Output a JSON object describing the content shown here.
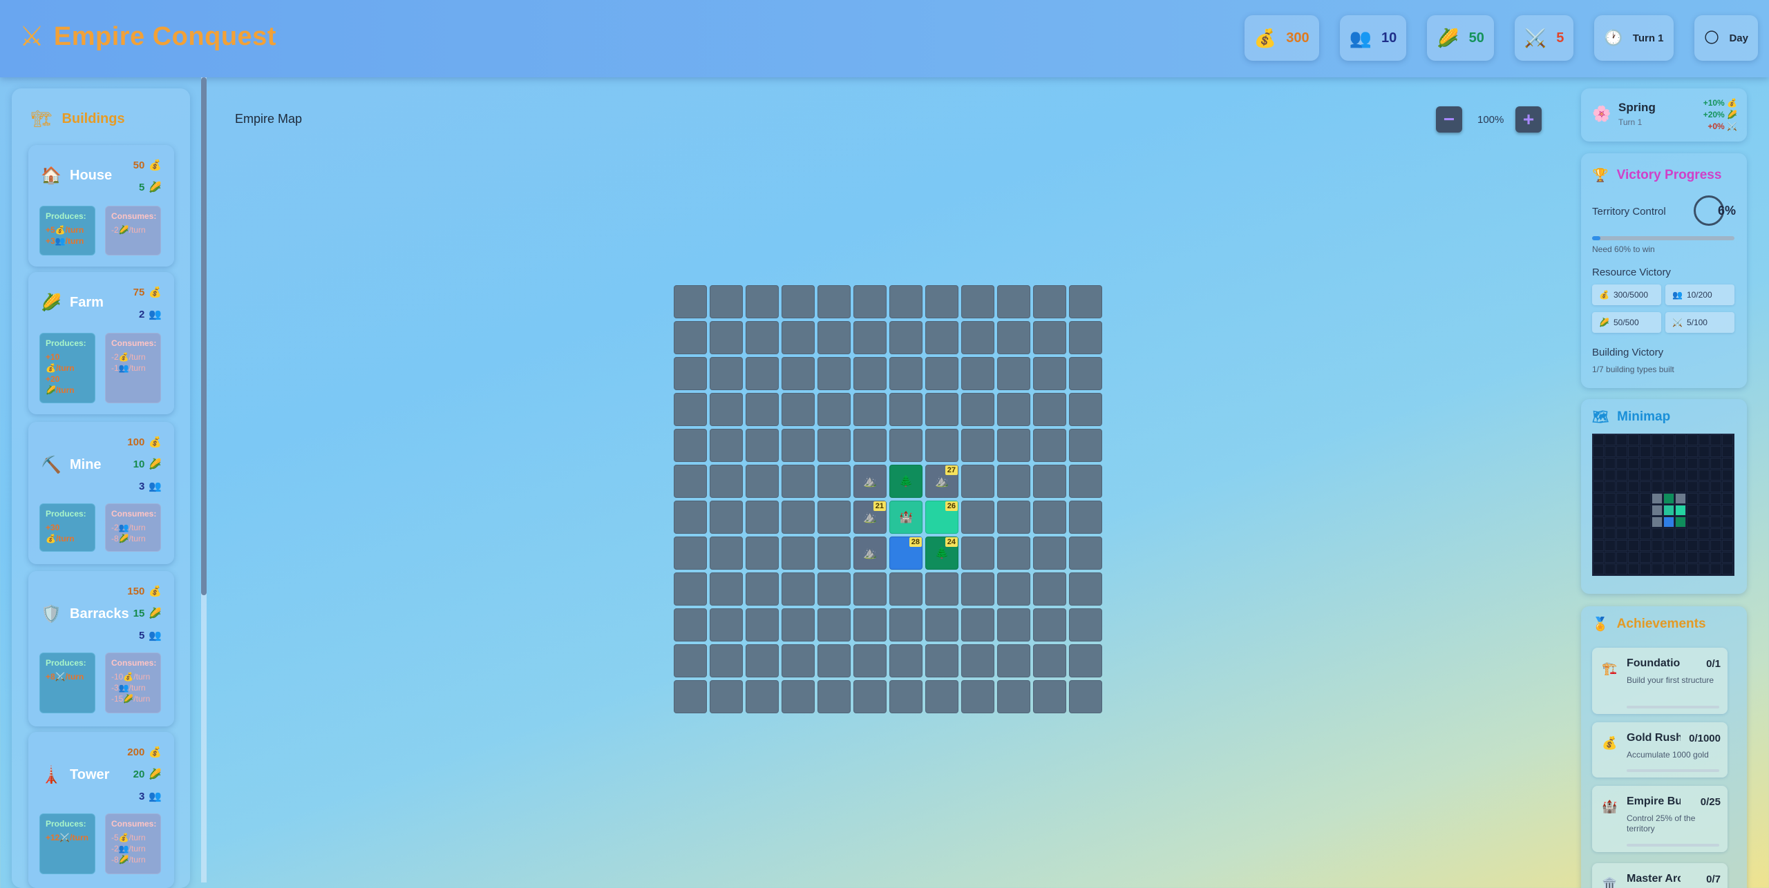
{
  "header": {
    "title": "Empire Conquest",
    "stats": [
      {
        "name": "gold",
        "icon": "💰",
        "value": "300",
        "color": "#e07a1f"
      },
      {
        "name": "population",
        "icon": "👥",
        "value": "10",
        "color": "#1f2f8a"
      },
      {
        "name": "food",
        "icon": "🌽",
        "value": "50",
        "color": "#15935a"
      },
      {
        "name": "military",
        "icon": "⚔️",
        "value": "5",
        "color": "#e2452b"
      },
      {
        "name": "turn",
        "icon": "🕐",
        "value": "Turn 1",
        "color": "#1e2a3a"
      },
      {
        "name": "time",
        "icon": "🌕",
        "value": "Day",
        "color": "#1e2a3a"
      }
    ]
  },
  "sidebar": {
    "title": "Buildings",
    "buildings": [
      {
        "name": "House",
        "icon": "🏠",
        "costs": [
          {
            "v": "50",
            "i": "💰",
            "t": "gold"
          },
          {
            "v": "5",
            "i": "🌽",
            "t": "food"
          }
        ],
        "produces": [
          "+5💰/turn",
          "+3👥/turn"
        ],
        "consumes": [
          "-2🌽/turn"
        ]
      },
      {
        "name": "Farm",
        "icon": "🌽",
        "costs": [
          {
            "v": "75",
            "i": "💰",
            "t": "gold"
          },
          {
            "v": "2",
            "i": "👥",
            "t": "pop"
          }
        ],
        "produces": [
          "+10",
          "💰/turn",
          "+20",
          "🌽/turn"
        ],
        "consumes": [
          "-2💰/turn",
          "-1👥/turn"
        ]
      },
      {
        "name": "Mine",
        "icon": "⛏️",
        "costs": [
          {
            "v": "100",
            "i": "💰",
            "t": "gold"
          },
          {
            "v": "10",
            "i": "🌽",
            "t": "food"
          },
          {
            "v": "3",
            "i": "👥",
            "t": "pop"
          }
        ],
        "produces": [
          "+30",
          "💰/turn"
        ],
        "consumes": [
          "-2👥/turn",
          "-8🌽/turn"
        ]
      },
      {
        "name": "Barracks",
        "icon": "🛡️",
        "costs": [
          {
            "v": "150",
            "i": "💰",
            "t": "gold"
          },
          {
            "v": "15",
            "i": "🌽",
            "t": "food"
          },
          {
            "v": "5",
            "i": "👥",
            "t": "pop"
          }
        ],
        "produces": [
          "+8⚔️/turn"
        ],
        "consumes": [
          "-10💰/turn",
          "-3👥/turn",
          "-15🌽/turn"
        ]
      },
      {
        "name": "Tower",
        "icon": "🗼",
        "costs": [
          {
            "v": "200",
            "i": "💰",
            "t": "gold"
          },
          {
            "v": "20",
            "i": "🌽",
            "t": "food"
          },
          {
            "v": "3",
            "i": "👥",
            "t": "pop"
          }
        ],
        "produces": [
          "+12⚔️/turn"
        ],
        "consumes": [
          "-5💰/turn",
          "-2👥/turn",
          "-8🌽/turn"
        ]
      }
    ]
  },
  "map": {
    "title": "Empire Map",
    "zoom_out": "−",
    "zoom_in": "+",
    "zoom": "100%",
    "cols": 12,
    "rows": 12,
    "tiles": [
      {
        "r": 5,
        "c": 5,
        "type": "mount",
        "icon": "⛰️",
        "badge": ""
      },
      {
        "r": 5,
        "c": 6,
        "type": "forest",
        "icon": "🌲",
        "badge": ""
      },
      {
        "r": 5,
        "c": 7,
        "type": "mount",
        "icon": "⛰️",
        "badge": "27"
      },
      {
        "r": 6,
        "c": 5,
        "type": "mount",
        "icon": "⛰️",
        "badge": "21"
      },
      {
        "r": 6,
        "c": 6,
        "type": "castle",
        "icon": "🏰",
        "badge": ""
      },
      {
        "r": 6,
        "c": 7,
        "type": "plains",
        "icon": "",
        "badge": "26"
      },
      {
        "r": 7,
        "c": 5,
        "type": "mount",
        "icon": "⛰️",
        "badge": ""
      },
      {
        "r": 7,
        "c": 6,
        "type": "water",
        "icon": "",
        "badge": "28"
      },
      {
        "r": 7,
        "c": 7,
        "type": "forest",
        "icon": "🌲",
        "badge": "24"
      }
    ]
  },
  "season": {
    "icon": "🌸",
    "name": "Spring",
    "sub": "Turn 1",
    "mods": [
      {
        "t": "+10% 💰",
        "c": "#15935a"
      },
      {
        "t": "+20% 🌽",
        "c": "#15935a"
      },
      {
        "t": "+0% ⚔️",
        "c": "#c43b2a"
      }
    ]
  },
  "victory": {
    "title": "Victory Progress",
    "territory_label": "Territory Control",
    "territory_pct": "6%",
    "territory_fraction": 0.06,
    "territory_note": "Need 60% to win",
    "resource_label": "Resource Victory",
    "resources": [
      {
        "icon": "💰",
        "text": "300/5000"
      },
      {
        "icon": "👥",
        "text": "10/200"
      },
      {
        "icon": "🌽",
        "text": "50/500"
      },
      {
        "icon": "⚔️",
        "text": "5/100"
      }
    ],
    "building_label": "Building Victory",
    "building_note": "1/7 building types built"
  },
  "minimap": {
    "title": "Minimap",
    "tiles": [
      {
        "r": 5,
        "c": 5,
        "color": "#6b7a8c"
      },
      {
        "r": 5,
        "c": 6,
        "color": "#0f8d5b"
      },
      {
        "r": 5,
        "c": 7,
        "color": "#6b7a8c"
      },
      {
        "r": 6,
        "c": 5,
        "color": "#6b7a8c"
      },
      {
        "r": 6,
        "c": 6,
        "color": "#27c49a"
      },
      {
        "r": 6,
        "c": 7,
        "color": "#25d3a1"
      },
      {
        "r": 7,
        "c": 5,
        "color": "#6b7a8c"
      },
      {
        "r": 7,
        "c": 6,
        "color": "#2f7fe5"
      },
      {
        "r": 7,
        "c": 7,
        "color": "#0f8d5b"
      }
    ]
  },
  "achievements": {
    "title": "Achievements",
    "items": [
      {
        "icon": "🏗️",
        "name": "Foundation",
        "progress": "0/1",
        "desc": "Build your first structure"
      },
      {
        "icon": "💰",
        "name": "Gold Rush",
        "progress": "0/1000",
        "desc": "Accumulate 1000 gold"
      },
      {
        "icon": "🏰",
        "name": "Empire Builder",
        "progress": "0/25",
        "desc": "Control 25% of the territory"
      },
      {
        "icon": "🏛️",
        "name": "Master Architect",
        "progress": "0/7",
        "desc": ""
      }
    ]
  }
}
